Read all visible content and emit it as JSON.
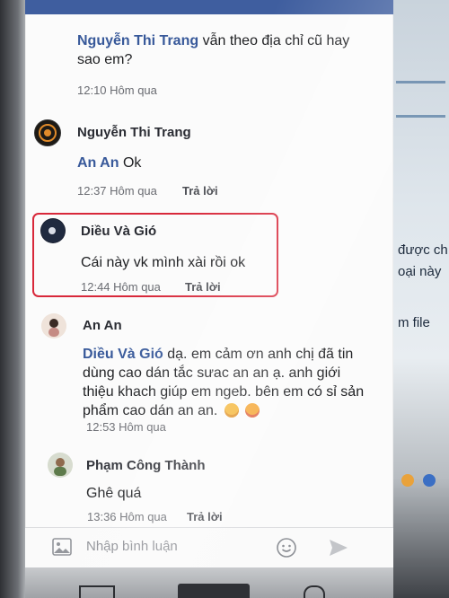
{
  "comments": [
    {
      "author": "Nguyễn Thi Trang",
      "text": "vẫn theo địa chỉ cũ hay sao em?",
      "time": "12:10 Hôm qua"
    },
    {
      "author": "Nguyễn Thi Trang",
      "mention": "An An",
      "text": "Ok",
      "time": "12:37 Hôm qua",
      "reply": "Trả lời"
    },
    {
      "author": "Diều Và Gió",
      "text": "Cái này vk mình xài rồi ok",
      "time": "12:44 Hôm qua",
      "reply": "Trả lời"
    },
    {
      "author": "An An",
      "mention": "Diều Và Gió",
      "text_lines": [
        "dạ. em cảm ơn anh chị đã tin",
        "dùng cao dán tắc sưac an an ạ. anh giới",
        "thiệu khach giúp em ngeb. bên em có sỉ sản",
        "phẩm cao dán an an."
      ],
      "time": "12:53 Hôm qua"
    },
    {
      "author": "Phạm Công Thành",
      "text": "Ghê quá",
      "time": "13:36 Hôm qua",
      "reply": "Trả lời"
    }
  ],
  "composer": {
    "placeholder": "Nhập bình luận",
    "icons": [
      "image-icon",
      "smiley-icon",
      "send-icon"
    ]
  },
  "background_monitor": {
    "lines": [
      "được ch",
      "oại này",
      "m file"
    ]
  },
  "colors": {
    "status_bar": "#3f5e9f",
    "mention": "#38599a",
    "highlight": "#d8283a"
  }
}
